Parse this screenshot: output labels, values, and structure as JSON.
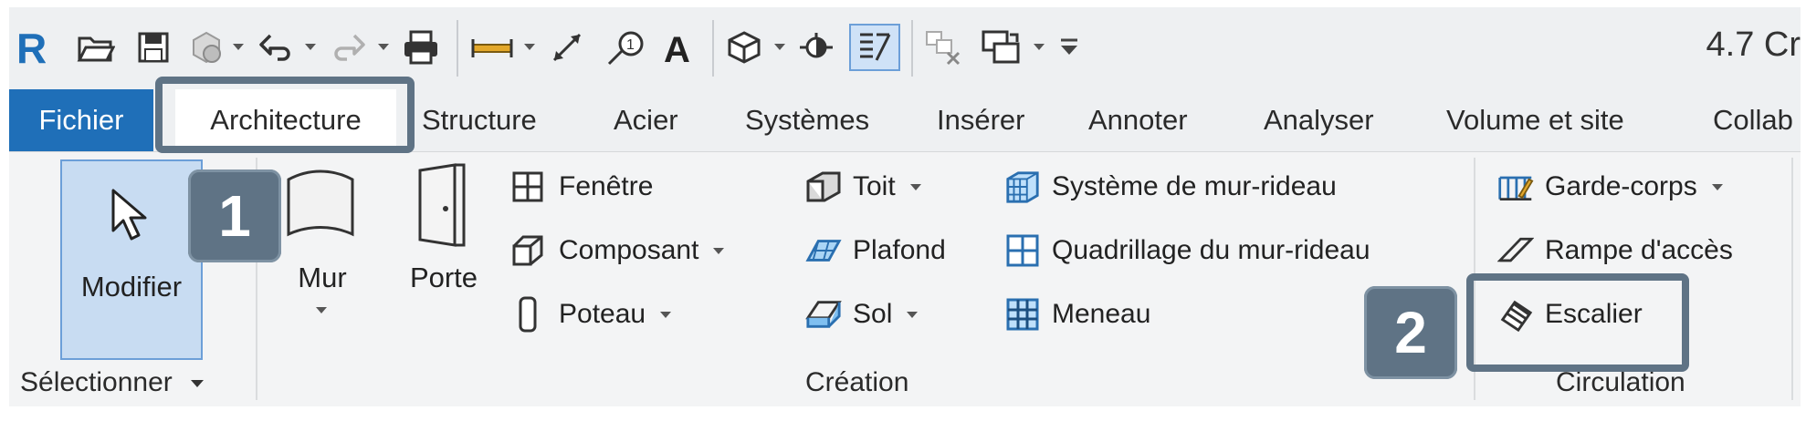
{
  "app": {
    "title_fragment": "4.7 Cr"
  },
  "qat": {
    "icons": [
      "revit-logo-icon",
      "open-folder-icon",
      "save-icon",
      "sync-icon",
      "undo-icon",
      "redo-icon",
      "print-icon",
      "measure-icon",
      "aligned-dimension-icon",
      "tag-icon",
      "text-icon",
      "3d-view-icon",
      "section-icon",
      "thin-lines-icon",
      "close-hidden-windows-icon",
      "switch-windows-icon",
      "customize-qat-icon"
    ]
  },
  "tabs": {
    "file": "Fichier",
    "items": [
      "Architecture",
      "Structure",
      "Acier",
      "Systèmes",
      "Insérer",
      "Annoter",
      "Analyser",
      "Volume et site",
      "Collab"
    ]
  },
  "ribbon": {
    "select_panel": {
      "modify": "Modifier",
      "label": "Sélectionner"
    },
    "build_panel": {
      "wall": "Mur",
      "door": "Porte",
      "window": "Fenêtre",
      "component": "Composant",
      "column": "Poteau",
      "roof": "Toit",
      "ceiling": "Plafond",
      "floor": "Sol",
      "curtain_system": "Système de mur-rideau",
      "curtain_grid": "Quadrillage du mur-rideau",
      "mullion": "Meneau",
      "label": "Création"
    },
    "circulation_panel": {
      "railing": "Garde-corps",
      "ramp": "Rampe d'accès",
      "stair": "Escalier",
      "label": "Circulation"
    }
  },
  "callouts": {
    "step1": "1",
    "step2": "2"
  },
  "colors": {
    "file_tab": "#1f6fb8",
    "callout": "#5f7385",
    "modify_bg": "#c8dcf2"
  }
}
